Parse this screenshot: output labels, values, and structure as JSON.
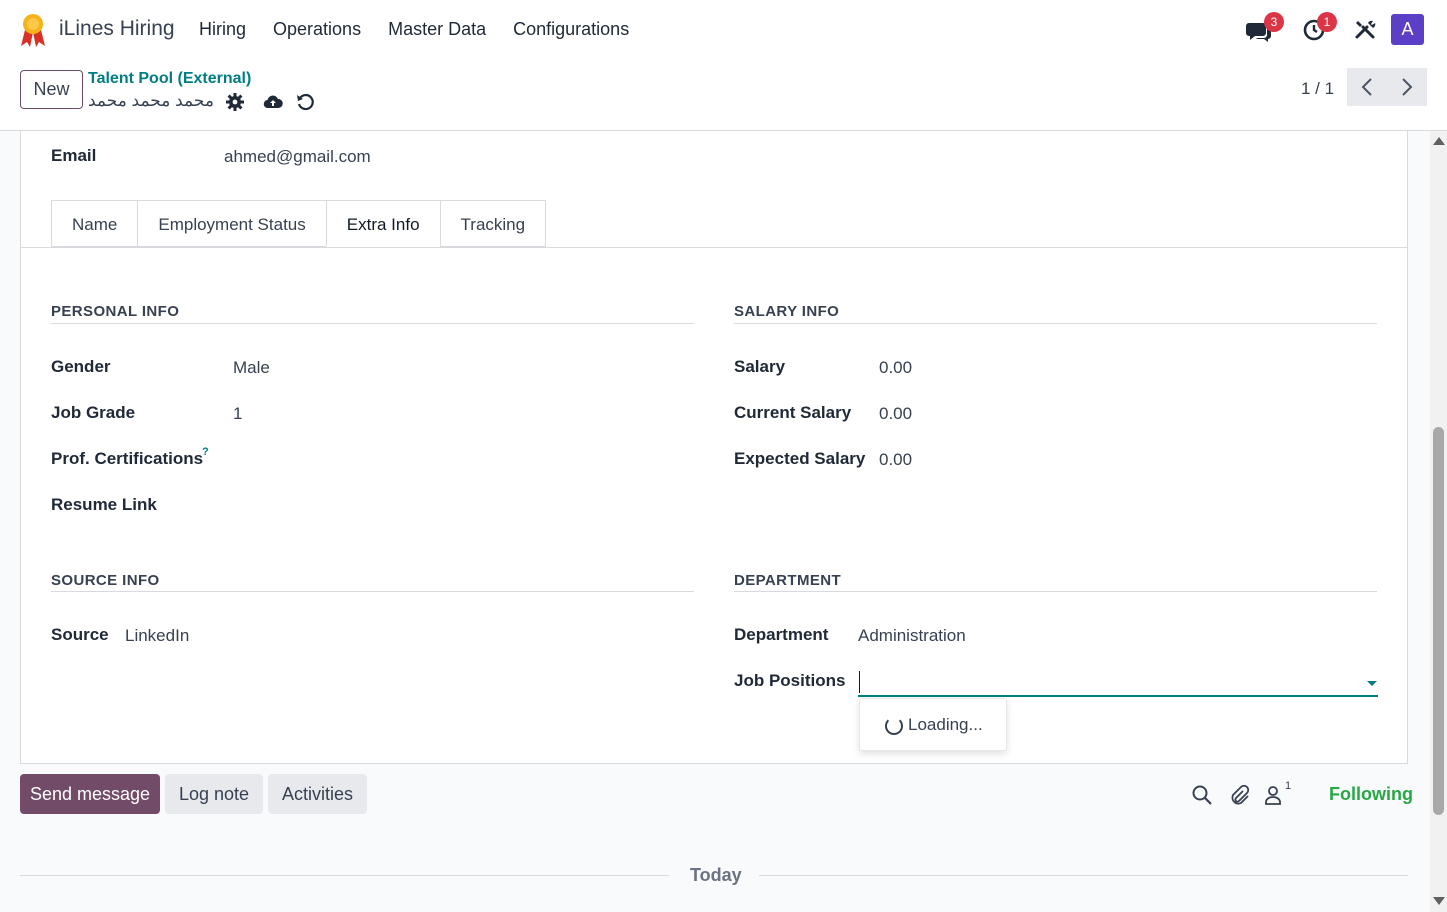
{
  "navbar": {
    "app_name": "iLines Hiring",
    "menu": [
      "Hiring",
      "Operations",
      "Master Data",
      "Configurations"
    ],
    "messages_badge": "3",
    "activities_badge": "1",
    "avatar_letter": "A"
  },
  "control": {
    "new_label": "New",
    "breadcrumb": "Talent Pool (External)",
    "record_name": "محمد محمد محمد",
    "pager": "1 / 1"
  },
  "form": {
    "email_label": "Email",
    "email_value": "ahmed@gmail.com",
    "tabs": [
      "Name",
      "Employment Status",
      "Extra Info",
      "Tracking"
    ],
    "active_tab": "Extra Info",
    "personal_info": {
      "title": "PERSONAL INFO",
      "gender_label": "Gender",
      "gender_value": "Male",
      "job_grade_label": "Job Grade",
      "job_grade_value": "1",
      "certifications_label": "Prof. Certifications",
      "certifications_help": "?",
      "resume_label": "Resume Link"
    },
    "salary_info": {
      "title": "SALARY INFO",
      "salary_label": "Salary",
      "salary_value": "0.00",
      "current_label": "Current Salary",
      "current_value": "0.00",
      "expected_label": "Expected Salary",
      "expected_value": "0.00"
    },
    "source_info": {
      "title": "SOURCE INFO",
      "source_label": "Source",
      "source_value": "LinkedIn"
    },
    "department": {
      "title": "DEPARTMENT",
      "department_label": "Department",
      "department_value": "Administration",
      "job_positions_label": "Job Positions",
      "job_positions_value": "",
      "dropdown_loading": "Loading..."
    }
  },
  "chatter": {
    "send_message": "Send message",
    "log_note": "Log note",
    "activities": "Activities",
    "followers_count": "1",
    "following": "Following",
    "today": "Today"
  },
  "colors": {
    "brand": "#714b67",
    "accent": "#017e84",
    "following": "#28a745",
    "badge": "#dc3545",
    "avatar": "#5b3fc7"
  }
}
